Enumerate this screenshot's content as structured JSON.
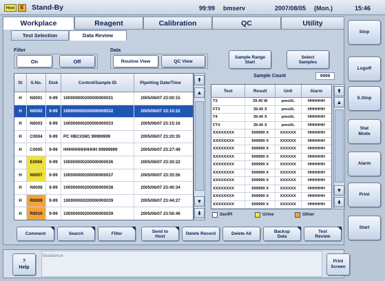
{
  "topbar": {
    "ind1": "Host",
    "ind2": "E",
    "status": "Stand-By",
    "code": "99:99",
    "host": "bmserv",
    "date": "2007/08/05",
    "day": "(Mon.)",
    "time": "15:46"
  },
  "tabs": [
    "Workplace",
    "Reagent",
    "Calibration",
    "QC",
    "Utility"
  ],
  "subtabs": [
    "Test Selection",
    "Data Review"
  ],
  "filter": {
    "label": "Filter",
    "on": "On",
    "off": "Off"
  },
  "data": {
    "label": "Data",
    "routine": "Routine View",
    "qc": "QC View"
  },
  "actions": {
    "range": "Sample Range Start",
    "select": "Select Samples"
  },
  "sample_count": {
    "label": "Sample Count",
    "value": "9999"
  },
  "left_headers": [
    "St",
    "S.No.",
    "Disk",
    "Control/Sample ID",
    "Pipetting Date/Time"
  ],
  "left_rows": [
    [
      "H",
      "N0001",
      "9-99",
      "100000000200000000031",
      "2005/06/07 23:00:15"
    ],
    [
      "H",
      "N0002",
      "9-99",
      "100000000200000000032",
      "2005/06/07 23:10:22"
    ],
    [
      "H",
      "N0003",
      "9-99",
      "100000000200000000033",
      "2005/06/07 23:15:16"
    ],
    [
      "H",
      "C0004",
      "9-99",
      "PC HBCIGM1 99999999",
      "2005/06/07 23:20:35"
    ],
    [
      "H",
      "C0005",
      "9-99",
      "HHHHHHHHHHH 99999999",
      "2005/06/07 23:27:49"
    ],
    [
      "H",
      "E0006",
      "9-99",
      "100000000200000000036",
      "2005/06/07 23:30:22"
    ],
    [
      "H",
      "N0007",
      "9-99",
      "100000000200000000037",
      "2005/06/07 23:35:56"
    ],
    [
      "H",
      "N0008",
      "9-99",
      "100000000200000000038",
      "2005/06/07 23:40:34"
    ],
    [
      "H",
      "R0009",
      "9-99",
      "100000000200000000039",
      "2005/06/07 23:44:27"
    ],
    [
      "H",
      "R0010",
      "9-99",
      "100000000200000000039",
      "2005/06/07 23:56:46"
    ]
  ],
  "right_headers": [
    "Test",
    "Result",
    "Unit",
    "Alarm"
  ],
  "right_rows": [
    [
      "T3",
      "39.40 W",
      "pmol/L",
      "HHHHHH"
    ],
    [
      "FT3",
      "39.40 X",
      "pmol/L",
      "HHHHHH"
    ],
    [
      "T4",
      "39.40 X",
      "pmol/L",
      "HHHHHH"
    ],
    [
      "FT4",
      "39.40 X",
      "pmol/L",
      "HHHHHH"
    ],
    [
      "XXXXXXXX",
      "999999 X",
      "XXXXXX",
      "HHHHHH"
    ],
    [
      "XXXXXXXX",
      "999999 X",
      "XXXXXX",
      "HHHHHH"
    ],
    [
      "XXXXXXXX",
      "999999 X",
      "XXXXXX",
      "HHHHHH"
    ],
    [
      "XXXXXXXX",
      "999999 X",
      "XXXXXX",
      "HHHHHH"
    ],
    [
      "XXXXXXXX",
      "999999 X",
      "XXXXXX",
      "HHHHHH"
    ],
    [
      "XXXXXXXX",
      "999999 X",
      "XXXXXX",
      "HHHHHH"
    ],
    [
      "XXXXXXXX",
      "999999 X",
      "XXXXXX",
      "HHHHHH"
    ],
    [
      "XXXXXXXX",
      "999999 X",
      "XXXXXX",
      "HHHHHH"
    ],
    [
      "XXXXXXXX",
      "999999 X",
      "XXXXXX",
      "HHHHHH"
    ],
    [
      "XXXXXXXX",
      "999999 X",
      "XXXXXX",
      "HHHHHH"
    ]
  ],
  "legend": [
    {
      "label": "Ser/Pl",
      "color": "#ffffff"
    },
    {
      "label": "Urine",
      "color": "#f2e23a"
    },
    {
      "label": "Other",
      "color": "#f3a33a"
    }
  ],
  "sno_colors": {
    "E0006": "#f2e23a",
    "N0007": "#f2e23a",
    "R0009": "#f3a33a",
    "R0010": "#f3a33a"
  },
  "bottom_buttons": [
    "Comment",
    "Search",
    "Filter",
    "Send to Host",
    "Delete Record",
    "Delete All",
    "Backup Data",
    "Test Review"
  ],
  "guidance": "Guidance",
  "help": {
    "q": "?",
    "label": "Help"
  },
  "print_screen": "Print Screen",
  "right_buttons": [
    "Stop",
    "Logoff",
    "S.Stop",
    "Stat Mode",
    "Alarm",
    "Print",
    "Start"
  ]
}
